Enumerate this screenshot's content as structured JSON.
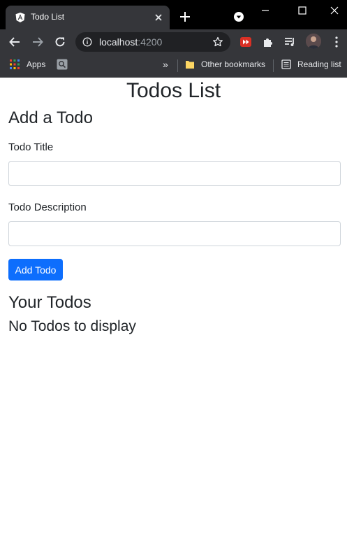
{
  "browser": {
    "tab": {
      "title": "Todo List",
      "favicon": "angular-logo-icon"
    },
    "url": {
      "host": "localhost",
      "port": ":4200"
    },
    "bookmarks": {
      "apps_label": "Apps",
      "overflow_label": "»",
      "other_label": "Other bookmarks",
      "reading_label": "Reading list"
    },
    "extension_icons": [
      "media-extension-icon",
      "puzzle-extensions-icon",
      "media-queue-icon"
    ],
    "colors": {
      "frame": "#000000",
      "toolbar": "#35363a",
      "omnibox": "#202124"
    }
  },
  "page": {
    "title": "Todos List",
    "add_heading": "Add a Todo",
    "title_label": "Todo Title",
    "title_value": "",
    "description_label": "Todo Description",
    "description_value": "",
    "add_button": "Add Todo",
    "your_heading": "Your Todos",
    "empty_message": "No Todos to display",
    "colors": {
      "primary": "#0d6efd",
      "text": "#212529",
      "input_border": "#ced4da"
    }
  }
}
